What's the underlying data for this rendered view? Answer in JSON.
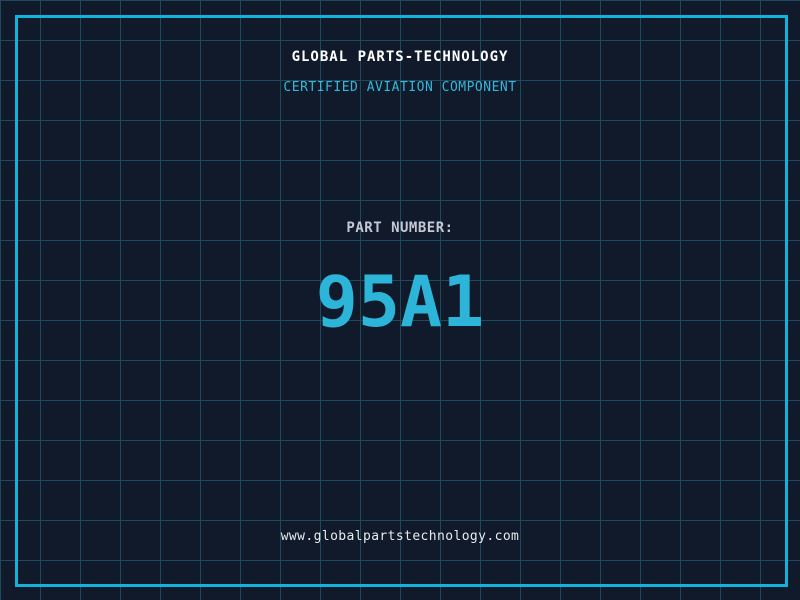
{
  "label": {
    "company_name": "GLOBAL PARTS-TECHNOLOGY",
    "certification_line": "CERTIFIED AVIATION COMPONENT",
    "part_number_label": "PART NUMBER:",
    "part_number": "95A1",
    "website": "www.globalpartstechnology.com",
    "colors": {
      "background": "#101a2b",
      "grid_line": "#1c4a5f",
      "frame_border": "#10b4da",
      "part_number_text": "#2cb5d8",
      "certification_text": "#38b6d8",
      "company_text": "#ffffff",
      "part_number_label_text": "#c3c8d2",
      "website_text": "#e8ebee"
    },
    "grid_cell_size_px": 40
  }
}
